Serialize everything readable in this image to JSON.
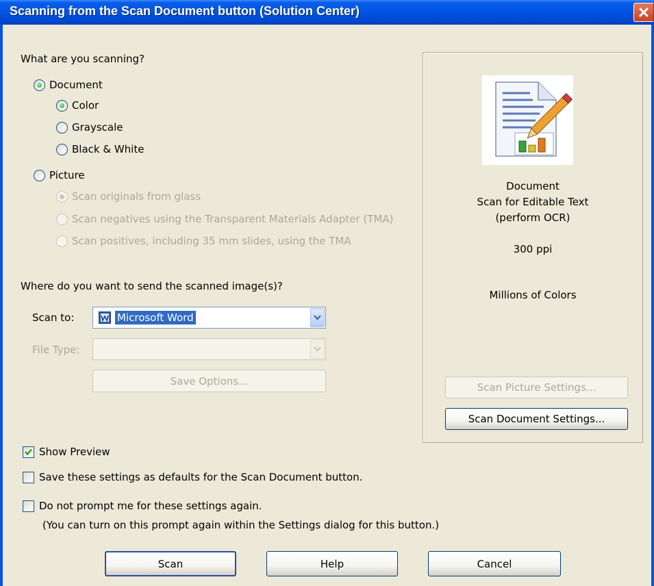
{
  "window": {
    "title": "Scanning from the Scan Document button (Solution Center)"
  },
  "section_scan_type": {
    "heading": "What are you scanning?",
    "document_label": "Document",
    "color_label": "Color",
    "grayscale_label": "Grayscale",
    "bw_label": "Black & White",
    "picture_label": "Picture",
    "picture_glass_label": "Scan originals from glass",
    "picture_negatives_label": "Scan negatives using the Transparent Materials Adapter (TMA)",
    "picture_positives_label": "Scan positives, including 35 mm slides, using the TMA",
    "selected_type": "Document",
    "selected_color_mode": "Color"
  },
  "section_destination": {
    "heading": "Where do you want to send the scanned image(s)?",
    "scan_to_label": "Scan to:",
    "scan_to_value": "Microsoft Word",
    "file_type_label": "File Type:",
    "file_type_value": "",
    "save_options_label": "Save Options..."
  },
  "preview": {
    "line1": "Document",
    "line2": "Scan for Editable Text",
    "line3": "(perform OCR)",
    "resolution": "300 ppi",
    "color_depth": "Millions of Colors",
    "scan_picture_settings_label": "Scan Picture Settings...",
    "scan_document_settings_label": "Scan Document Settings..."
  },
  "options": {
    "show_preview_label": "Show Preview",
    "show_preview_checked": true,
    "save_defaults_label": "Save these settings as defaults for the Scan Document button.",
    "save_defaults_checked": false,
    "no_prompt_label": "Do not prompt me for these settings again.",
    "no_prompt_note": "(You can turn on this prompt again within the Settings dialog for this button.)",
    "no_prompt_checked": false
  },
  "footer": {
    "scan_label": "Scan",
    "help_label": "Help",
    "cancel_label": "Cancel"
  },
  "colors": {
    "titlebar": "#0055e5",
    "dialog_bg": "#ece9d8",
    "selection": "#316ac5",
    "disabled_text": "#aca899"
  }
}
